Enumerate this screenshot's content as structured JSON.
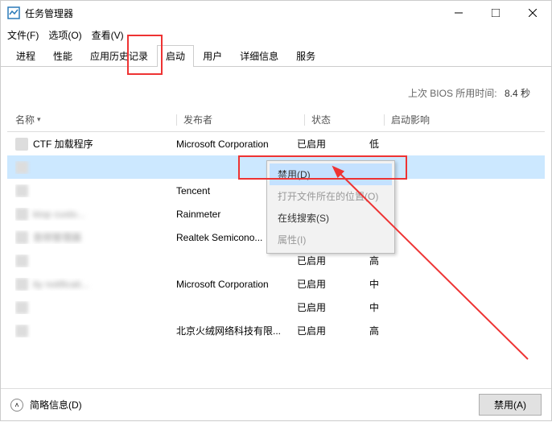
{
  "window": {
    "title": "任务管理器"
  },
  "menu": {
    "file": "文件(F)",
    "options": "选项(O)",
    "view": "查看(V)"
  },
  "tabs": {
    "processes": "进程",
    "performance": "性能",
    "app_history": "应用历史记录",
    "startup": "启动",
    "users": "用户",
    "details": "详细信息",
    "services": "服务"
  },
  "bios": {
    "label": "上次 BIOS 所用时间:",
    "value": "8.4 秒"
  },
  "headers": {
    "name": "名称",
    "publisher": "发布者",
    "status": "状态",
    "impact": "启动影响"
  },
  "rows": [
    {
      "name": "CTF 加载程序",
      "publisher": "Microsoft Corporation",
      "status": "已启用",
      "impact": "低",
      "blur": false
    },
    {
      "name": "",
      "publisher": "",
      "status": "",
      "impact": "",
      "blur": true,
      "selected": true
    },
    {
      "name": "",
      "publisher": "Tencent",
      "status": "",
      "impact": "",
      "blur": true
    },
    {
      "name": "ktop custo...",
      "publisher": "Rainmeter",
      "status": "",
      "impact": "",
      "blur": true
    },
    {
      "name": "音频管理器",
      "publisher": "Realtek Semicono...",
      "status": "",
      "impact": "",
      "blur": true
    },
    {
      "name": "",
      "publisher": "",
      "status": "已启用",
      "impact": "高",
      "blur": true
    },
    {
      "name": "ity notificati...",
      "publisher": "Microsoft Corporation",
      "status": "已启用",
      "impact": "中",
      "blur": true
    },
    {
      "name": "",
      "publisher": "",
      "status": "已启用",
      "impact": "中",
      "blur": true
    },
    {
      "name": "",
      "publisher": "北京火绒网络科技有限...",
      "status": "已启用",
      "impact": "高",
      "blur": true
    }
  ],
  "context_menu": {
    "disable": "禁用(D)",
    "open_location": "打开文件所在的位置(O)",
    "search_online": "在线搜索(S)",
    "properties": "属性(I)"
  },
  "footer": {
    "brief": "简略信息(D)",
    "disable_btn": "禁用(A)"
  }
}
